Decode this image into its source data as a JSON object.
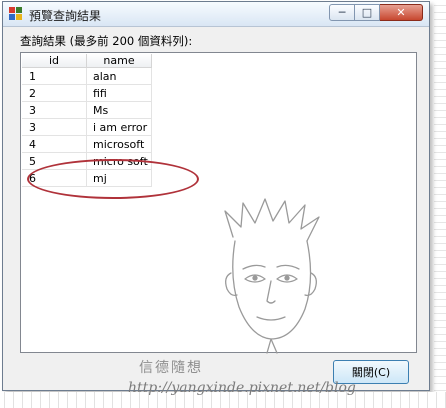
{
  "window": {
    "title": "預覽查詢結果",
    "controls": {
      "minimize": "─",
      "maximize": "□",
      "close": "✕"
    }
  },
  "caption": "查詢結果 (最多前 200 個資料列):",
  "table": {
    "columns": [
      "id",
      "name"
    ],
    "rows": [
      [
        "1",
        "alan"
      ],
      [
        "2",
        "fifi"
      ],
      [
        "3",
        "Ms"
      ],
      [
        "3",
        "i am error"
      ],
      [
        "4",
        "microsoft"
      ],
      [
        "5",
        "micro soft"
      ],
      [
        "6",
        "mj"
      ]
    ]
  },
  "buttons": {
    "close_label": "關閉(C)"
  },
  "watermark": {
    "name": "信德隨想",
    "url": "http://yangxinde.pixnet.net/blog"
  },
  "colors": {
    "highlight": "#b0323a",
    "button_border": "#3c7fb1"
  }
}
